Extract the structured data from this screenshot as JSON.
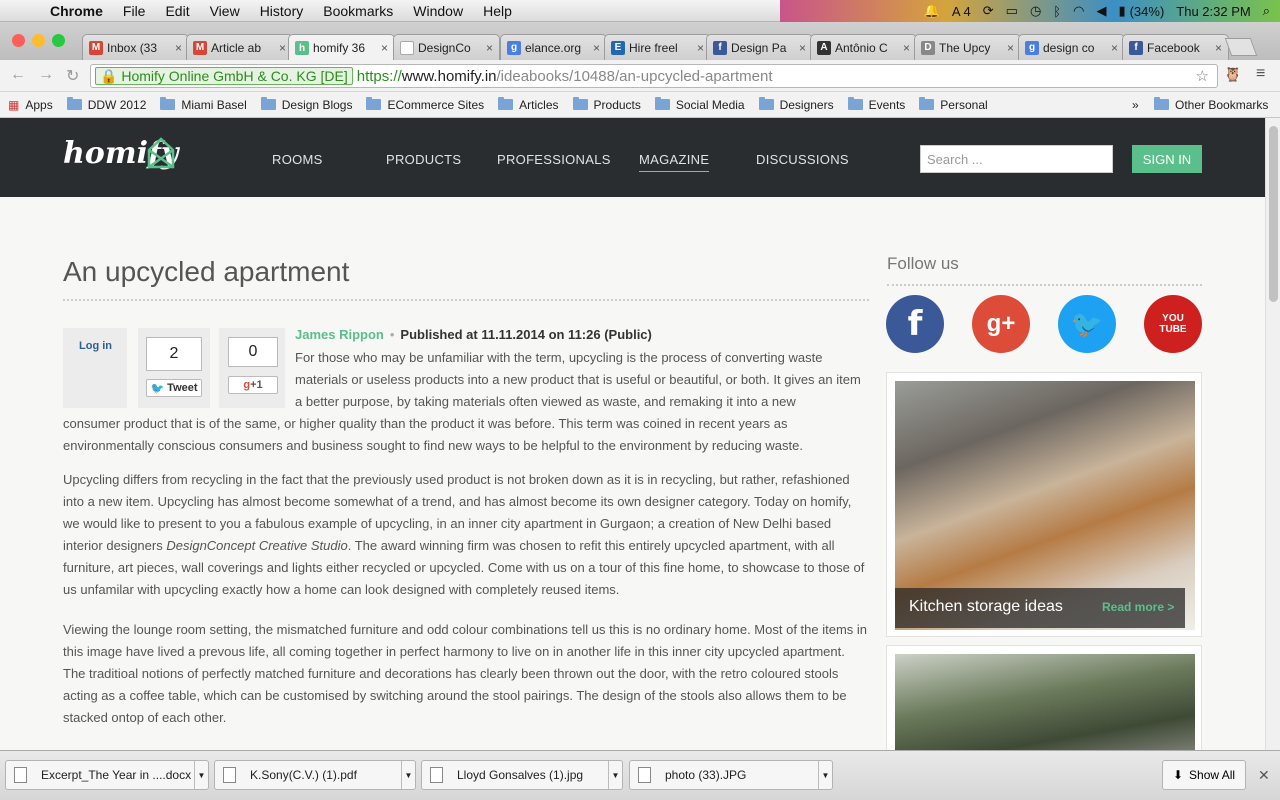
{
  "os_menu": {
    "app": "Chrome",
    "items": [
      "File",
      "Edit",
      "View",
      "History",
      "Bookmarks",
      "Window",
      "Help"
    ],
    "status_count": "4",
    "battery": "(34%)",
    "clock": "Thu 2:32 PM"
  },
  "tabs": [
    {
      "label": "Inbox (33",
      "fav": "M",
      "color": "#d44638"
    },
    {
      "label": "Article ab",
      "fav": "M",
      "color": "#d44638"
    },
    {
      "label": "homify 36",
      "fav": "h",
      "color": "#5bbf8b",
      "active": true
    },
    {
      "label": "DesignCo",
      "fav": "",
      "color": "#ffffff"
    },
    {
      "label": "elance.org",
      "fav": "g",
      "color": "#4a7ee0"
    },
    {
      "label": "Hire freel",
      "fav": "E",
      "color": "#2167b4"
    },
    {
      "label": "Design Pa",
      "fav": "f",
      "color": "#3b5998"
    },
    {
      "label": "Antônio C",
      "fav": "A",
      "color": "#333"
    },
    {
      "label": "The Upcy",
      "fav": "D",
      "color": "#888"
    },
    {
      "label": "design co",
      "fav": "g",
      "color": "#4a7ee0"
    },
    {
      "label": "Facebook",
      "fav": "f",
      "color": "#3b5998"
    }
  ],
  "address": {
    "ev": "Homify Online GmbH & Co. KG [DE]",
    "scheme": "https://",
    "host": "www.homify.in",
    "path": "/ideabooks/10488/an-upcycled-apartment"
  },
  "bookmarks": {
    "apps": "Apps",
    "items": [
      "DDW 2012",
      "Miami Basel",
      "Design Blogs",
      "ECommerce Sites",
      "Articles",
      "Products",
      "Social Media",
      "Designers",
      "Events",
      "Personal"
    ],
    "overflow": "»",
    "other": "Other Bookmarks"
  },
  "site": {
    "logo": "homify",
    "nav": [
      "ROOMS",
      "PRODUCTS",
      "PROFESSIONALS",
      "MAGAZINE",
      "DISCUSSIONS"
    ],
    "search_placeholder": "Search ...",
    "signin": "SIGN IN",
    "title": "An upcycled apartment",
    "login": "Log in",
    "tweet_count": "2",
    "tweet_label": "Tweet",
    "gplus_count": "0",
    "gplus_label": "+1",
    "author": "James Rippon",
    "published": "Published at 11.11.2014 on 11:26 (Public)",
    "p1a": "For those who may be unfamiliar with the term, upcycling is the process of converting waste materials or useless products into a new product that is useful or beautiful, or both. It gives an item a better purpose, by taking materials often viewed as waste, and remaking it into a new",
    "p1b": "consumer product that is of the same, or higher quality than the product it was before. This term was coined in recent years as environmentally conscious consumers and business sought to find new ways to be helpful to the environment by reducing waste.",
    "p2a": "Upcycling differs from recycling in the fact that the previously used product is not broken down as it is in recycling, but rather, refashioned into a new item. Upcycling has almost become somewhat of a trend, and has almost become its own designer category. Today on homify, we would like to present to you a fabulous example of upcycling, in an inner city apartment in Gurgaon; a creation of New Delhi based interior designers ",
    "p2em": "DesignConcept Creative Studio",
    "p2b": ". The award winning firm was chosen to refit this entirely upcycled apartment, with all furniture, art pieces, wall coverings and lights either recycled or upcycled. Come with us on a tour of this fine home, to showcase to those of us unfamilar with upcycling exactly how a home can look designed with completely reused items.",
    "p3": "Viewing the lounge room setting, the mismatched furniture and odd colour combinations tell us this is no ordinary home. Most of the items in this image have lived a prevous life, all coming together in perfect harmony to live on in another life in this inner city upcycled apartment. The traditioal notions of perfectly matched furniture and decorations has clearly been thrown out the door, with the retro coloured stools acting as a coffee table, which can be customised by switching around the stool pairings. The design of the stools also allows them to be stacked ontop of each other.",
    "follow": "Follow us",
    "card_title": "Kitchen storage ideas",
    "card_link": "Read more >"
  },
  "downloads": {
    "files": [
      "Excerpt_The Year in ....docx",
      "K.Sony(C.V.) (1).pdf",
      "Lloyd Gonsalves (1).jpg",
      "photo (33).JPG"
    ],
    "show_all": "Show All"
  },
  "colors": {
    "accent": "#5bbf8b",
    "header": "#2a2d30",
    "facebook": "#3b5998",
    "gplus": "#dd4b39",
    "twitter": "#1da1f2",
    "youtube": "#cd201f"
  }
}
